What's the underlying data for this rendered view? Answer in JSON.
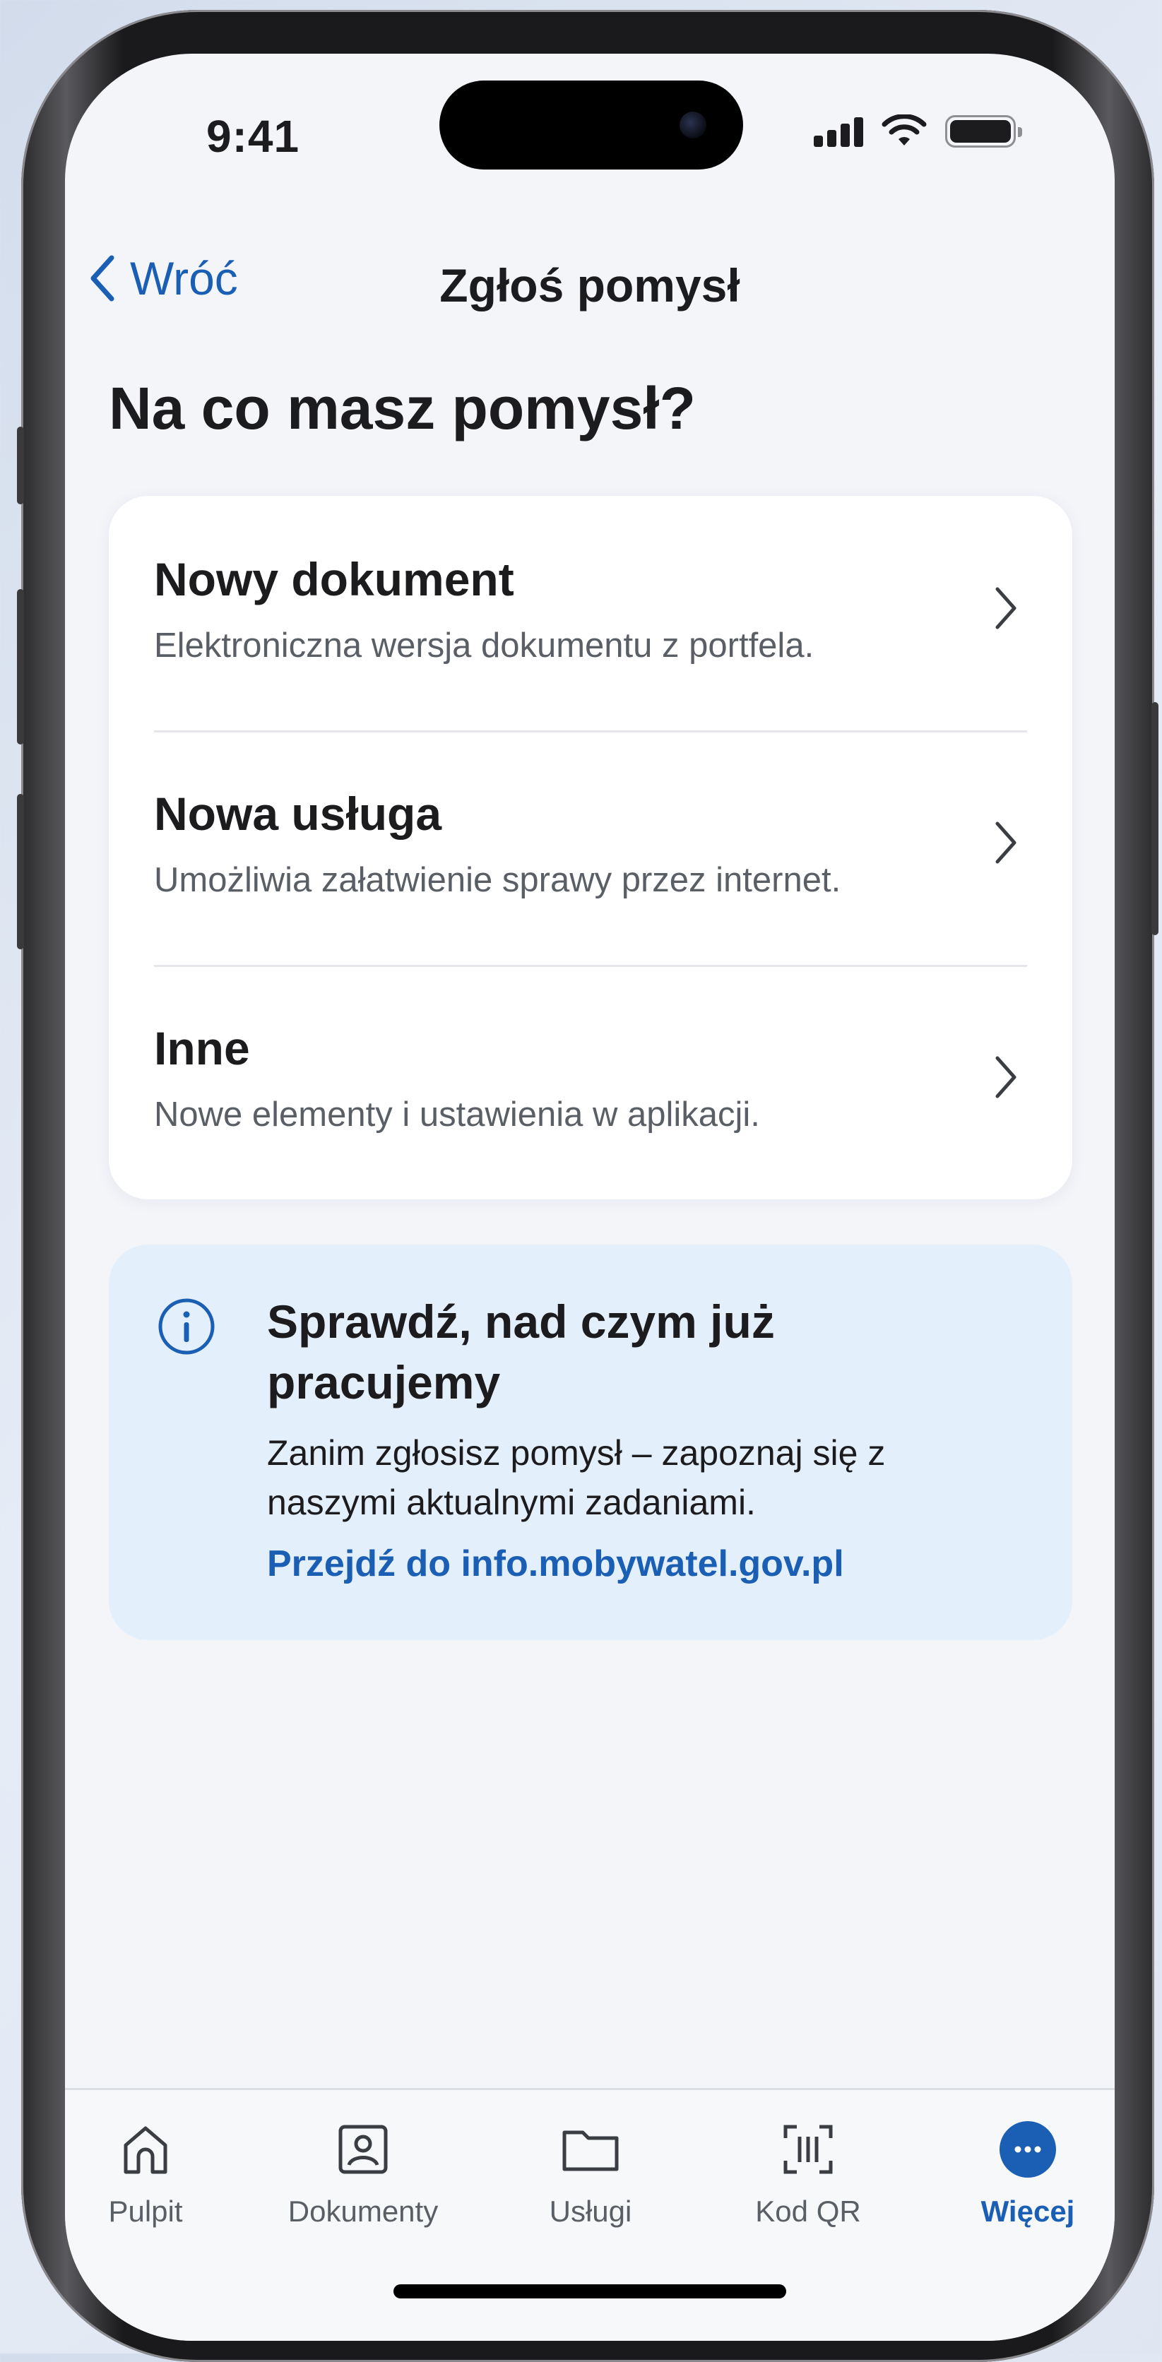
{
  "status_bar": {
    "time": "9:41"
  },
  "nav": {
    "back_label": "Wróć",
    "title": "Zgłoś pomysł"
  },
  "page": {
    "heading": "Na co masz pomysł?"
  },
  "options": [
    {
      "title": "Nowy dokument",
      "subtitle": "Elektroniczna wersja dokumentu z portfela."
    },
    {
      "title": "Nowa usługa",
      "subtitle": "Umożliwia załatwienie sprawy przez internet."
    },
    {
      "title": "Inne",
      "subtitle": "Nowe elementy i ustawienia w aplikacji."
    }
  ],
  "info": {
    "title": "Sprawdź, nad czym już pracujemy",
    "text": "Zanim zgłosisz pomysł – zapoznaj się z naszymi aktualnymi zadaniami.",
    "link": "Przejdź do info.mobywatel.gov.pl"
  },
  "tabs": [
    {
      "label": "Pulpit",
      "icon": "home-icon"
    },
    {
      "label": "Dokumenty",
      "icon": "id-card-icon"
    },
    {
      "label": "Usługi",
      "icon": "folder-icon"
    },
    {
      "label": "Kod QR",
      "icon": "qr-scan-icon"
    },
    {
      "label": "Więcej",
      "icon": "more-icon",
      "active": true
    }
  ],
  "colors": {
    "accent": "#1a5fb4",
    "info_bg": "#e4effc",
    "screen_bg": "#f3f5f9"
  }
}
